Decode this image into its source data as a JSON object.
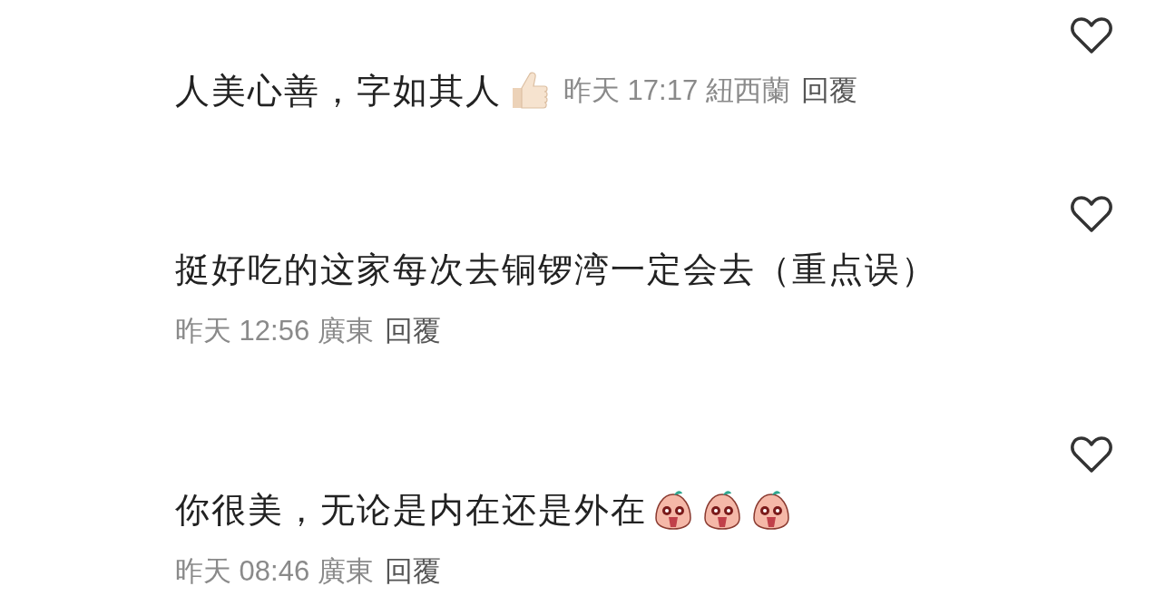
{
  "comments": [
    {
      "kind": "inline",
      "text": "人美心善，字如其人",
      "emoji": [
        {
          "kind": "thumbs_up"
        }
      ],
      "time": "昨天 17:17",
      "location": "紐西蘭",
      "reply": "回覆",
      "liked": false
    },
    {
      "kind": "below",
      "text": "挺好吃的这家每次去铜锣湾一定会去（重点误）",
      "time": "昨天 12:56",
      "location": "廣東",
      "reply": "回覆",
      "liked": false
    },
    {
      "kind": "below",
      "text": "你很美，无论是内在还是外在",
      "emoji": [
        {
          "kind": "peach_face"
        },
        {
          "kind": "peach_face"
        },
        {
          "kind": "peach_face"
        }
      ],
      "time": "昨天 08:46",
      "location": "廣東",
      "reply": "回覆",
      "liked": false
    }
  ]
}
